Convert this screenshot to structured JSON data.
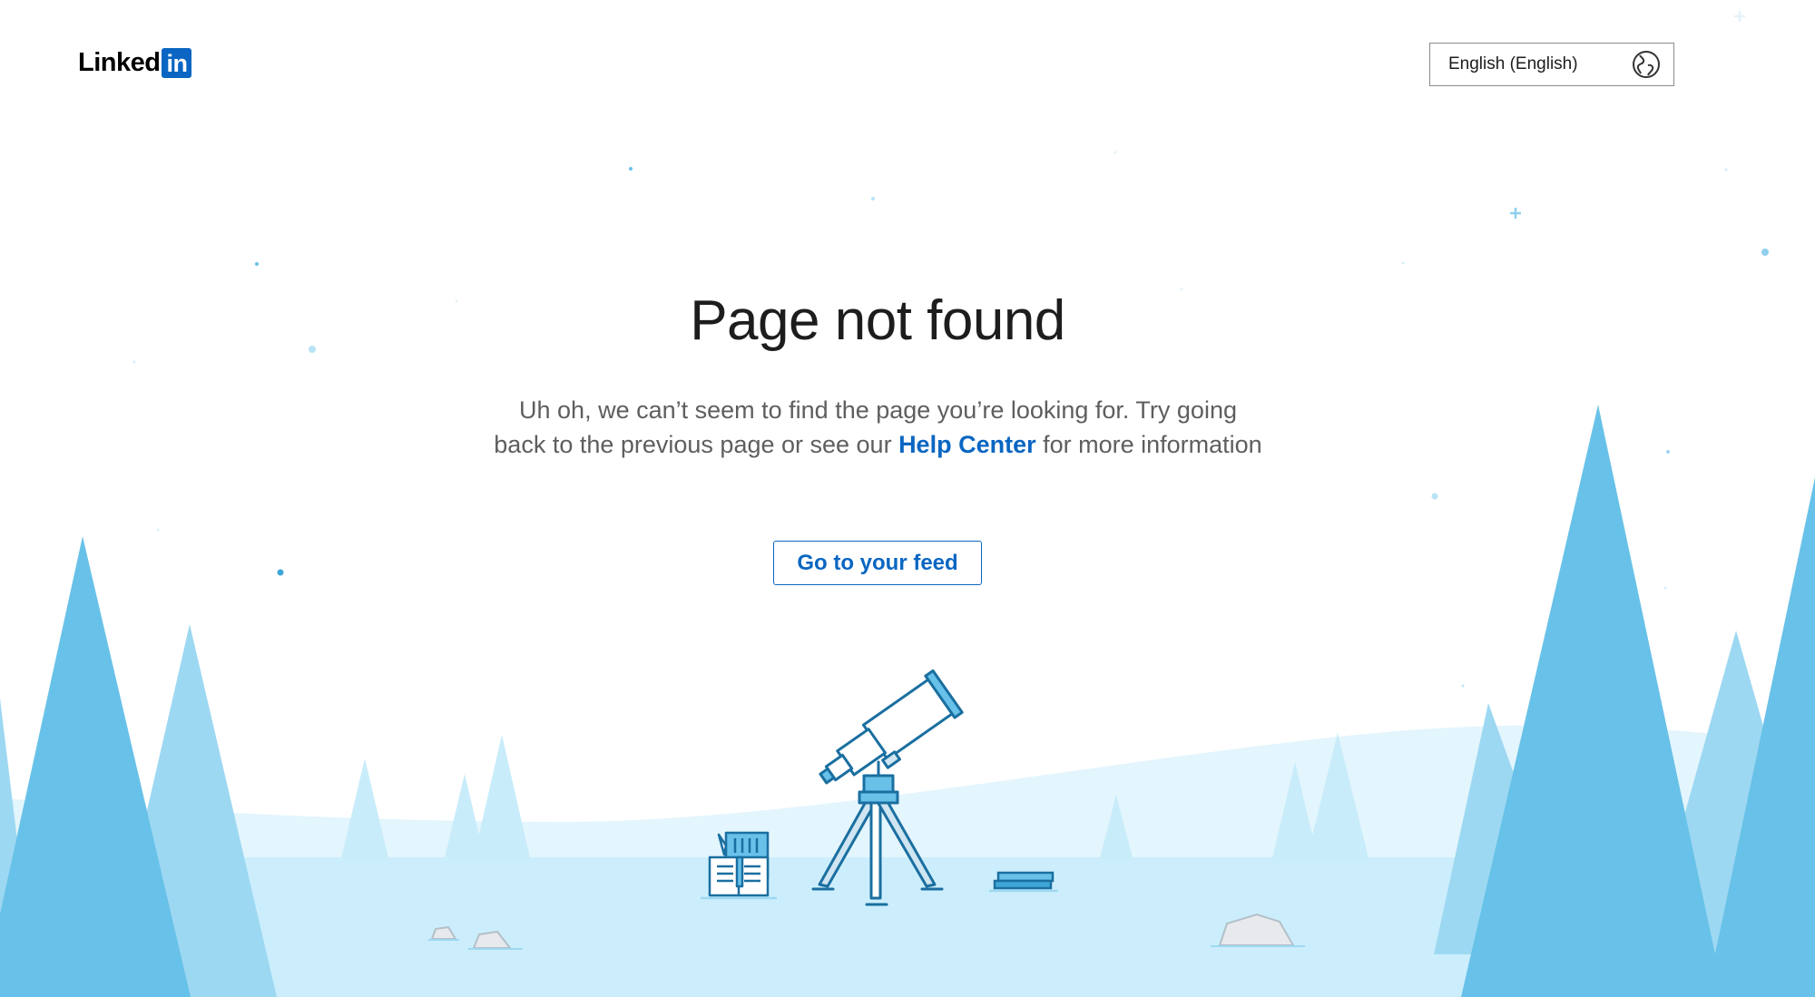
{
  "header": {
    "logo_word": "Linked",
    "logo_box": "in",
    "language": {
      "selected": "English (English)",
      "icon": "globe-icon"
    }
  },
  "main": {
    "title": "Page not found",
    "message_before_link": "Uh oh, we can’t seem to find the page you’re looking for. Try going back to the previous page or see our ",
    "help_link": "Help Center",
    "message_after_link": " for more information",
    "button": "Go to your feed"
  },
  "illustration": {
    "items": [
      "telescope",
      "open-book-with-crayons",
      "closed-book",
      "rocks",
      "trees"
    ]
  },
  "colors": {
    "brand_blue": "#0a66c2",
    "tree_dark": "#68c1e8",
    "tree_light": "#9dd8f2",
    "tree_pale": "#c8ecfa",
    "ground": "#cceefc",
    "hill": "#e3f5fd"
  }
}
